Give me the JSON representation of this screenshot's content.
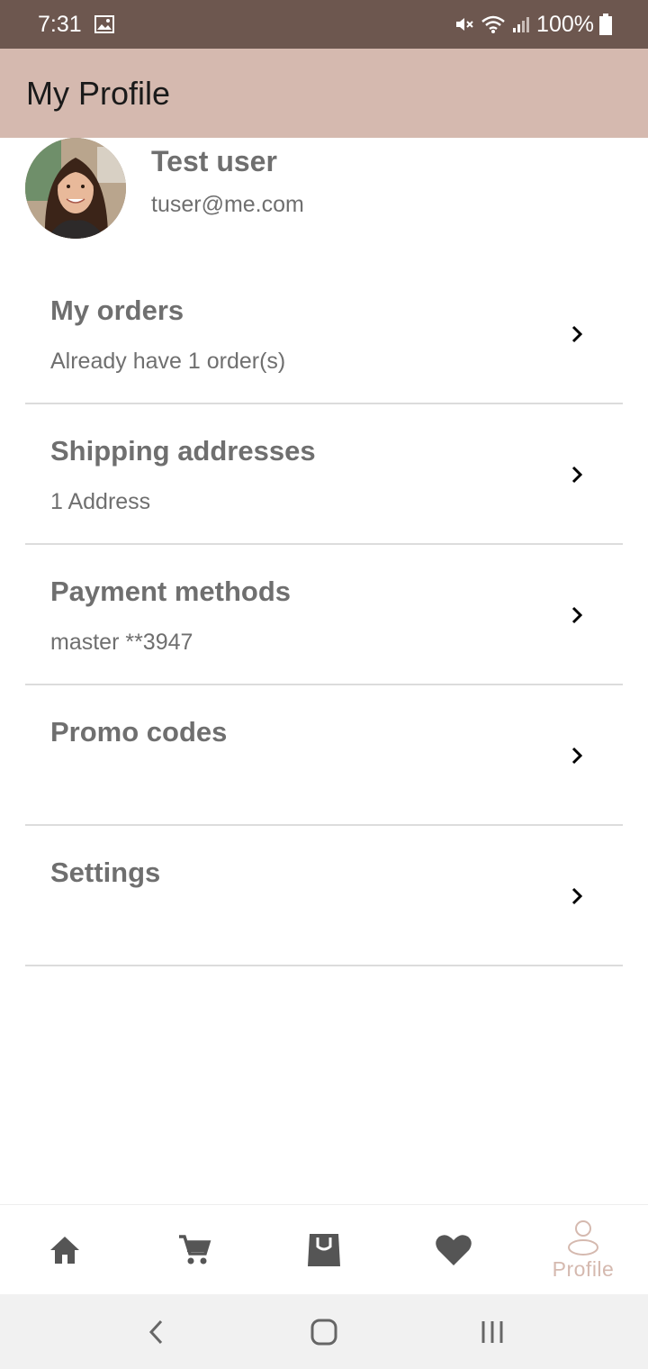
{
  "status_bar": {
    "time": "7:31",
    "battery": "100%",
    "icons": [
      "image-icon",
      "mute-icon",
      "wifi-icon",
      "signal-icon",
      "battery-icon"
    ]
  },
  "app_bar": {
    "title": "My Profile"
  },
  "profile": {
    "name": "Test user",
    "email": "tuser@me.com"
  },
  "menu": {
    "items": [
      {
        "title": "My orders",
        "subtitle": "Already have 1 order(s)"
      },
      {
        "title": "Shipping addresses",
        "subtitle": "1 Address"
      },
      {
        "title": "Payment methods",
        "subtitle": "master **3947"
      },
      {
        "title": "Promo codes",
        "subtitle": ""
      },
      {
        "title": "Settings",
        "subtitle": ""
      }
    ]
  },
  "bottom_nav": {
    "items": [
      {
        "icon": "home-icon",
        "label": ""
      },
      {
        "icon": "cart-icon",
        "label": ""
      },
      {
        "icon": "bag-icon",
        "label": ""
      },
      {
        "icon": "heart-icon",
        "label": ""
      },
      {
        "icon": "profile-icon",
        "label": "Profile",
        "active": true
      }
    ]
  },
  "colors": {
    "status_bar": "#6d574f",
    "app_bar": "#d5b9af",
    "text_gray": "#6f6f6f",
    "accent": "#d5b9af",
    "nav_icon": "#555555"
  }
}
